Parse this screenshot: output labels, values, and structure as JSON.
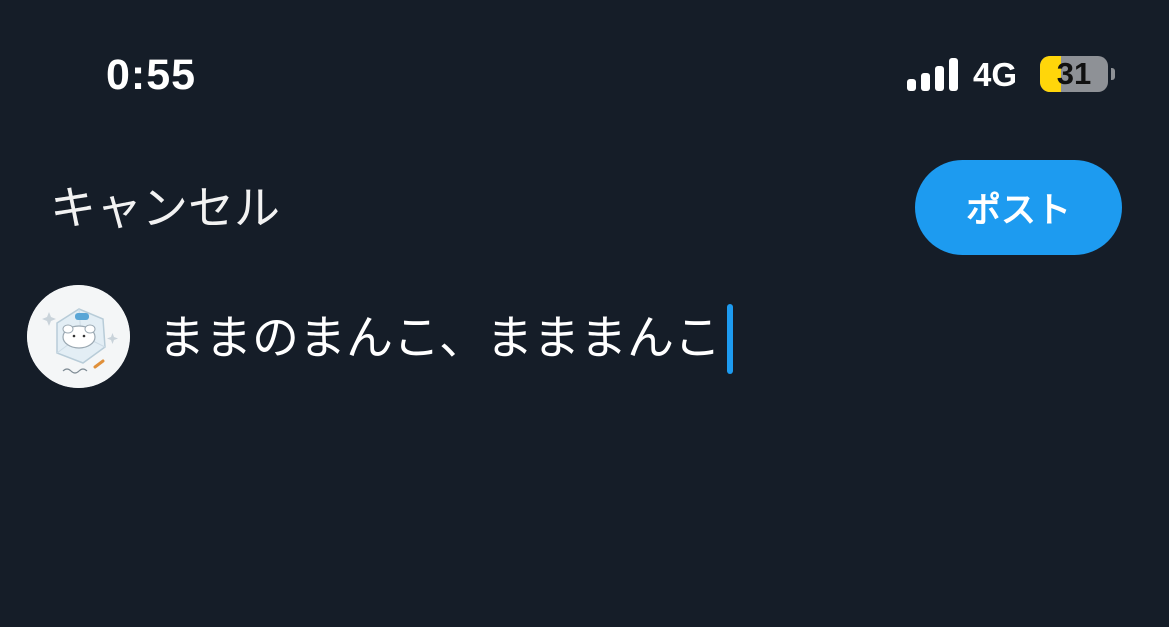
{
  "status_bar": {
    "time": "0:55",
    "network": "4G",
    "battery_level": "31",
    "battery_fraction": 0.31,
    "battery_color": "#ffd60a",
    "signal_icon": "cellular-signal-icon"
  },
  "compose": {
    "cancel_label": "キャンセル",
    "post_label": "ポスト",
    "text": "ままのまんこ、まままんこ"
  },
  "colors": {
    "background": "#151d28",
    "accent": "#1d9bf0"
  }
}
